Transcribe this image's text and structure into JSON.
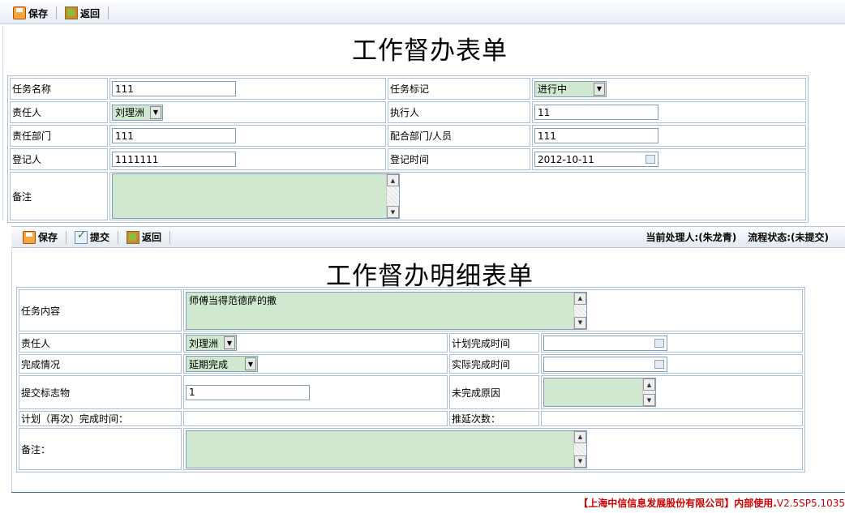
{
  "toolbar_top": {
    "save": "保存",
    "back": "返回"
  },
  "title1": "工作督办表单",
  "form1": {
    "task_name_label": "任务名称",
    "task_name": "111",
    "task_mark_label": "任务标记",
    "task_mark": "进行中",
    "owner_label": "责任人",
    "owner": "刘理洲",
    "executor_label": "执行人",
    "executor": "11",
    "dept_label": "责任部门",
    "dept": "111",
    "coop_label": "配合部门/人员",
    "coop": "111",
    "registrar_label": "登记人",
    "registrar": "1111111",
    "reg_time_label": "登记时间",
    "reg_time": "2012-10-11",
    "remark_label": "备注",
    "remark": ""
  },
  "toolbar_mid": {
    "save": "保存",
    "submit": "提交",
    "back": "返回",
    "handler": "当前处理人:(朱龙青)",
    "flow_status": "流程状态:(未提交)"
  },
  "title2": "工作督办明细表单",
  "form2": {
    "content_label": "任务内容",
    "content": "师傅当得范德萨的撒",
    "owner_label": "责任人",
    "owner": "刘理洲",
    "plan_time_label": "计划完成时间",
    "plan_time": "",
    "status_label": "完成情况",
    "status": "延期完成",
    "actual_time_label": "实际完成时间",
    "actual_time": "",
    "deliverable_label": "提交标志物",
    "deliverable": "1",
    "reason_label": "未完成原因",
    "reason": "",
    "replan_label": "计划（再次）完成时间：",
    "replan": "",
    "delay_label": "推延次数：",
    "delay": "",
    "remark_label": "备注：",
    "remark": ""
  },
  "footer": {
    "company": "【上海中信信息发展股份有限公司】内部使用.",
    "version": "V2.5SP5.1035"
  }
}
